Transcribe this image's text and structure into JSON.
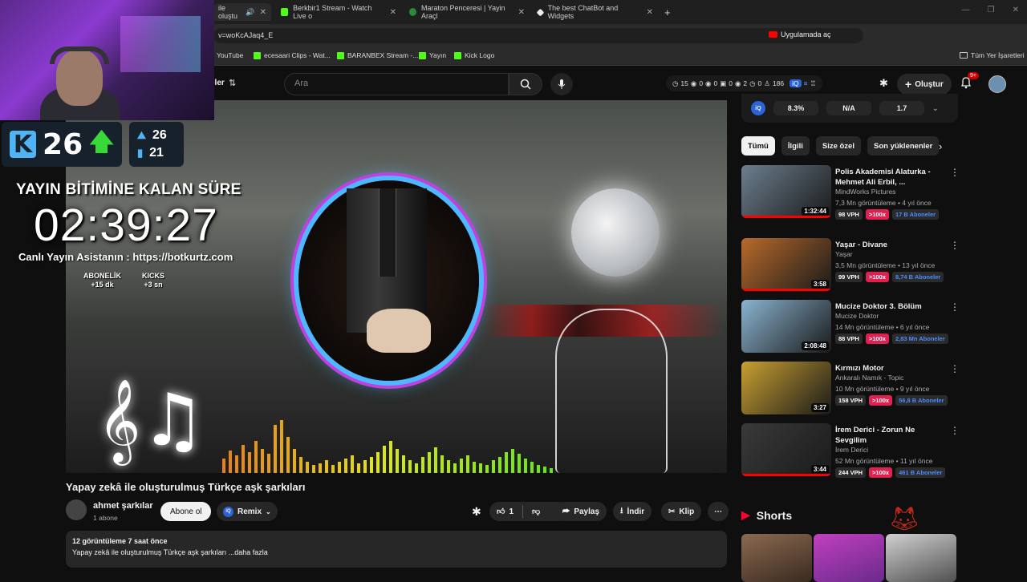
{
  "browser": {
    "tabs": [
      {
        "label": "ile oluştu",
        "active": true
      },
      {
        "label": "Berkbir1 Stream - Watch Live o"
      },
      {
        "label": "Maraton Penceresi | Yayin Araçl"
      },
      {
        "label": "The best ChatBot and Widgets"
      }
    ],
    "url": "v=woKcAJaq4_E",
    "open_in_app": "Uygulamada aç",
    "bookmarks": [
      "YouTube",
      "ecesaari Clips - Wat...",
      "BARANBEX Stream -...",
      "Yayın",
      "Kick Logo"
    ],
    "all_bookmarks": "Tüm Yer İşaretleri"
  },
  "youtube_header": {
    "left_label": "eler",
    "search_placeholder": "Ara",
    "stats": [
      "15",
      "0",
      "0",
      "0",
      "2",
      "0",
      "186"
    ],
    "create_label": "Oluştur",
    "notif_badge": "9+"
  },
  "stream_overlay": {
    "kick_count": "26",
    "rank_top": "26",
    "rank_bottom": "21",
    "timer_title": "YAYIN BİTİMİNE KALAN SÜRE",
    "timer": "02:39:27",
    "assistant": "Canlı Yayın Asistanın : https://botkurtz.com",
    "bonus_sub_label": "ABONELİK",
    "bonus_sub_value": "+15 dk",
    "bonus_kick_label": "KICKS",
    "bonus_kick_value": "+3 sn"
  },
  "video": {
    "title": "Yapay zekâ ile oluşturulmuş Türkçe aşk şarkıları",
    "channel": "ahmet şarkılar",
    "subscribers": "1 abone",
    "subscribe_label": "Abone ol",
    "remix_label": "Remix",
    "likes": "1",
    "share_label": "Paylaş",
    "download_label": "İndir",
    "clip_label": "Klip",
    "desc_stats": "12 görüntüleme  7 saat önce",
    "desc_text": "Yapay zekâ ile oluşturulmuş Türkçe aşk şarkıları ...daha fazla"
  },
  "iq_bar": {
    "v1": "8.3%",
    "v2": "N/A",
    "v3": "1.7"
  },
  "chips": [
    "Tümü",
    "İlgili",
    "Size özel",
    "Son yüklenenler"
  ],
  "recommendations": [
    {
      "title": "Polis Akademisi Alaturka - Mehmet Ali Erbil, ...",
      "channel": "MindWorks Pictures",
      "meta": "7,3 Mn görüntüleme • 4 yıl önce",
      "vph": "98 VPH",
      "hx": ">100x",
      "subs": "17 B Aboneler",
      "duration": "1:32:44",
      "color": "#6d7f8f"
    },
    {
      "title": "Yaşar - Divane",
      "channel": "Yaşar",
      "meta": "3,5 Mn görüntüleme • 13 yıl önce",
      "vph": "99 VPH",
      "hx": ">100x",
      "subs": "8,74 B Aboneler",
      "duration": "3:58",
      "color": "#b86a2a"
    },
    {
      "title": "Mucize Doktor 3. Bölüm",
      "channel": "Mucize Doktor",
      "meta": "14 Mn görüntüleme • 6 yıl önce",
      "vph": "88 VPH",
      "hx": ">100x",
      "subs": "2,83 Mn Aboneler",
      "duration": "2:08:48",
      "color": "#8ab4d0"
    },
    {
      "title": "Kırmızı Motor",
      "channel": "Ankaralı Namık - Topic",
      "meta": "10 Mn görüntüleme • 9 yıl önce",
      "vph": "158 VPH",
      "hx": ">100x",
      "subs": "56,8 B Aboneler",
      "duration": "3:27",
      "color": "#c8a030"
    },
    {
      "title": "İrem Derici - Zorun Ne Sevgilim",
      "channel": "İrem Derici",
      "meta": "52 Mn görüntüleme • 11 yıl önce",
      "vph": "244 VPH",
      "hx": ">100x",
      "subs": "461 B Aboneler",
      "duration": "3:44",
      "color": "#3a3a3a"
    }
  ],
  "shorts_label": "Shorts"
}
